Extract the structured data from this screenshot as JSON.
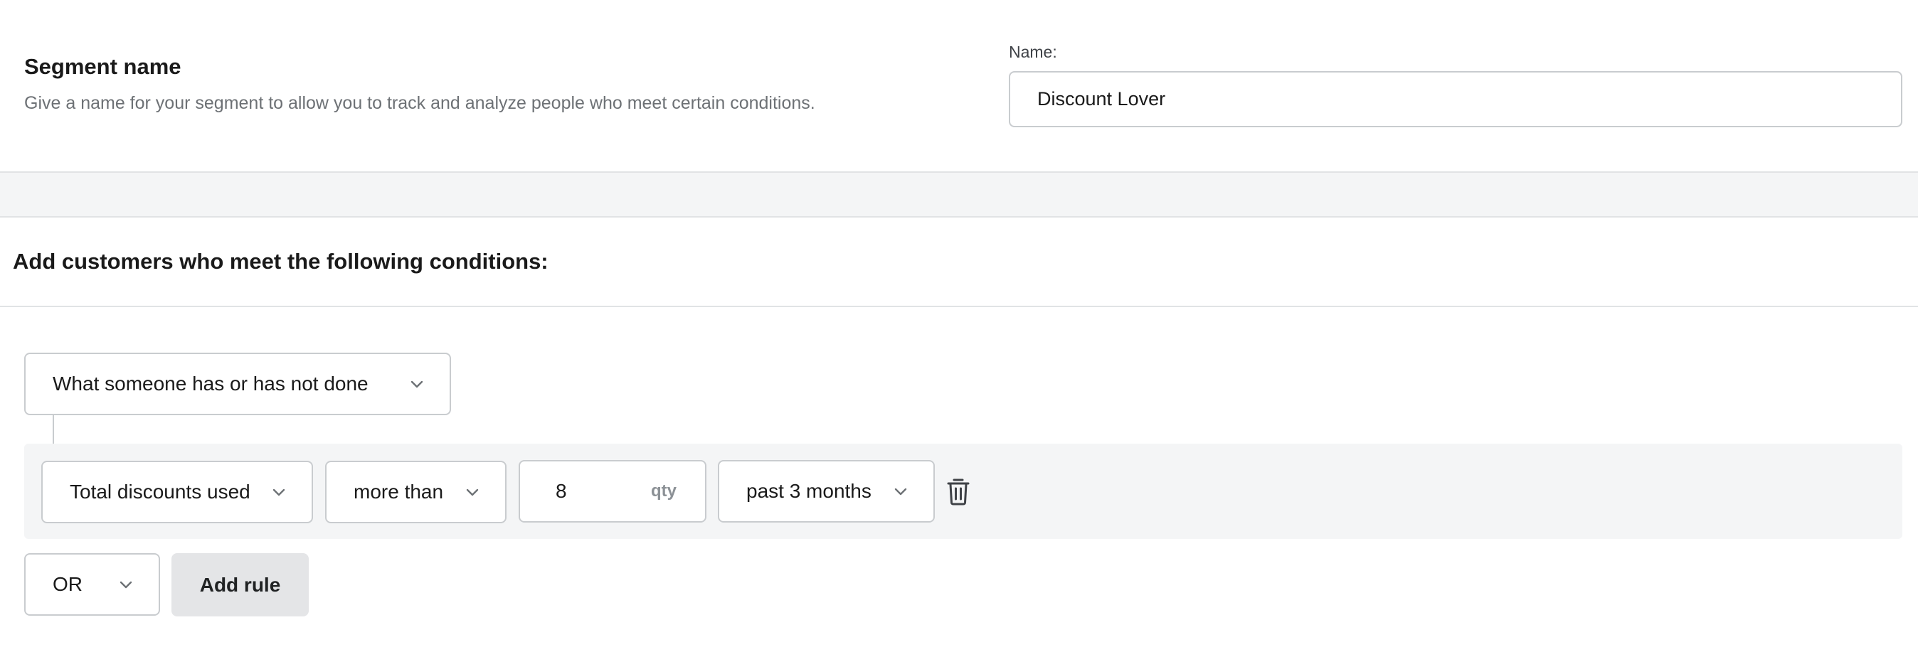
{
  "segment": {
    "title": "Segment name",
    "description": "Give a name for your segment to allow you to track and analyze people who meet certain conditions.",
    "name_label": "Name:",
    "name_value": "Discount Lover"
  },
  "conditions": {
    "title": "Add customers who meet the following conditions:",
    "condition_type": "What someone has or has not done",
    "rule": {
      "metric": "Total discounts used",
      "operator": "more than",
      "value": "8",
      "unit": "qty",
      "period": "past 3 months"
    },
    "logic_operator": "OR",
    "add_rule_label": "Add rule"
  },
  "icons": {
    "chevron": "chevron-down-icon",
    "delete": "trash-icon"
  },
  "colors": {
    "border": "#c9cccf",
    "muted_text": "#6d7175",
    "panel_bg": "#f4f5f6",
    "button_bg": "#e4e5e7"
  }
}
